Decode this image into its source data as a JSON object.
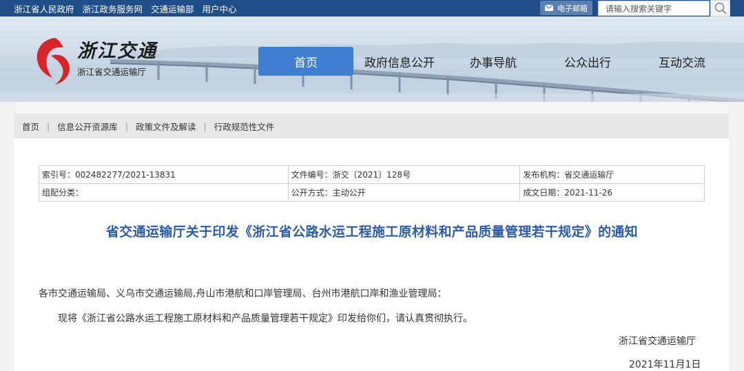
{
  "top_bar": {
    "links": [
      "浙江省人民政府",
      "浙江政务服务网",
      "交通运输部",
      "用户中心"
    ],
    "mail_label": "电子邮箱",
    "search_placeholder": "请输入搜索关键字"
  },
  "header": {
    "logo_title": "浙江交通",
    "logo_subtitle": "浙江省交通运输厅"
  },
  "nav": {
    "items": [
      {
        "label": "首页",
        "active": true
      },
      {
        "label": "政府信息公开",
        "active": false
      },
      {
        "label": "办事导航",
        "active": false
      },
      {
        "label": "公众出行",
        "active": false
      },
      {
        "label": "互动交流",
        "active": false
      }
    ]
  },
  "breadcrumb": [
    "首页",
    "信息公开资源库",
    "政策文件及解读",
    "行政规范性文件"
  ],
  "meta": {
    "row1": [
      "索引号：002482277/2021-13831",
      "文件编号：浙交〔2021〕128号",
      "发布机构：省交通运输厅"
    ],
    "row2": [
      "组配分类：",
      "公开方式：主动公开",
      "成文日期：2021-11-26"
    ]
  },
  "article": {
    "title": "省交通运输厅关于印发《浙江省公路水运工程施工原材料和产品质量管理若干规定》的通知",
    "recipients": "各市交通运输局、义乌市交通运输局,舟山市港航和口岸管理局、台州市港航口岸和渔业管理局：",
    "paragraph": "现将《浙江省公路水运工程施工原材料和产品质量管理若干规定》印发给你们，请认真贯彻执行。",
    "signature": "浙江省交通运输厅",
    "date": "2021年11月1日"
  },
  "colors": {
    "top_bar": "#1f4d88",
    "nav_active": "#3f7fd0",
    "title": "#2b5aa8",
    "logo_red": "#d7262b"
  }
}
